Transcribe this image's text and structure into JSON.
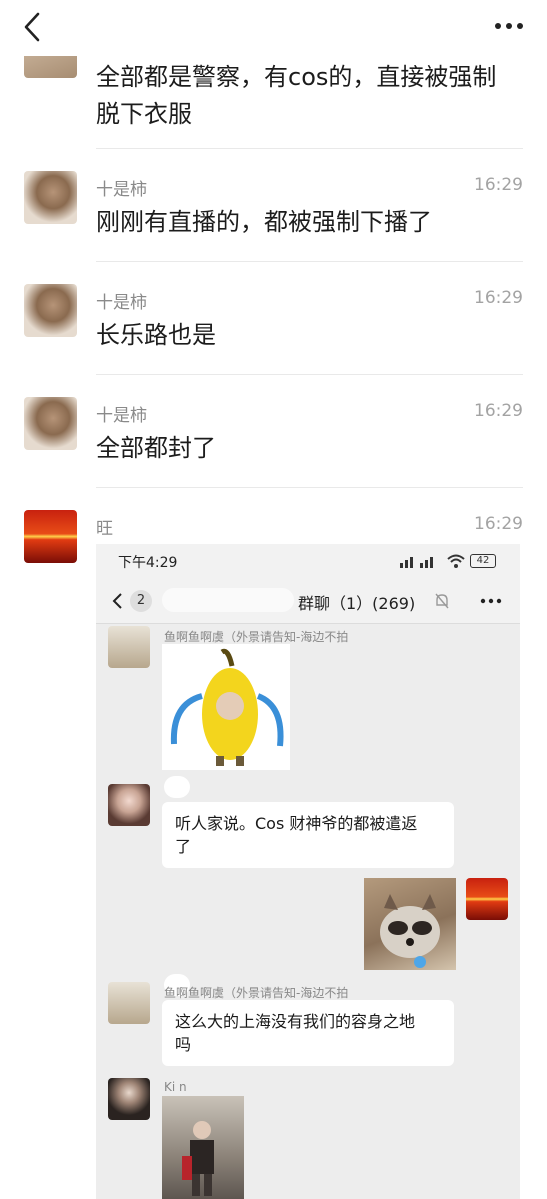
{
  "messages": [
    {
      "sender": "",
      "time": "",
      "text_lines": [
        "全部都是警察，有cos的，直接被强制",
        "脱下衣服"
      ]
    },
    {
      "sender": "十是柿",
      "time": "16:29",
      "text_lines": [
        "刚刚有直播的，都被强制下播了"
      ]
    },
    {
      "sender": "十是柿",
      "time": "16:29",
      "text_lines": [
        "长乐路也是"
      ]
    },
    {
      "sender": "十是柿",
      "time": "16:29",
      "text_lines": [
        "全部都封了"
      ]
    },
    {
      "sender": "旺",
      "time": "16:29",
      "text_lines": []
    }
  ],
  "screenshot": {
    "status_time": "下午4:29",
    "battery": "42",
    "back_count": "2",
    "chat_title": "群聊（1）(269)",
    "items": [
      {
        "sender": "鱼啊鱼啊虞（外景请告知-海边不拍",
        "kind": "image"
      },
      {
        "sender": "",
        "kind": "text",
        "lines": [
          "听人家说。Cos 财神爷的都被遣返",
          "了"
        ]
      },
      {
        "sender": "",
        "kind": "image-self"
      },
      {
        "sender": "鱼啊鱼啊虞（外景请告知-海边不拍",
        "kind": "text",
        "lines": [
          "这么大的上海没有我们的容身之地",
          "吗"
        ]
      },
      {
        "sender": "Ki n",
        "kind": "image"
      }
    ]
  },
  "icons": {
    "back": "chevron-left-icon",
    "more": "more-dots-icon"
  }
}
